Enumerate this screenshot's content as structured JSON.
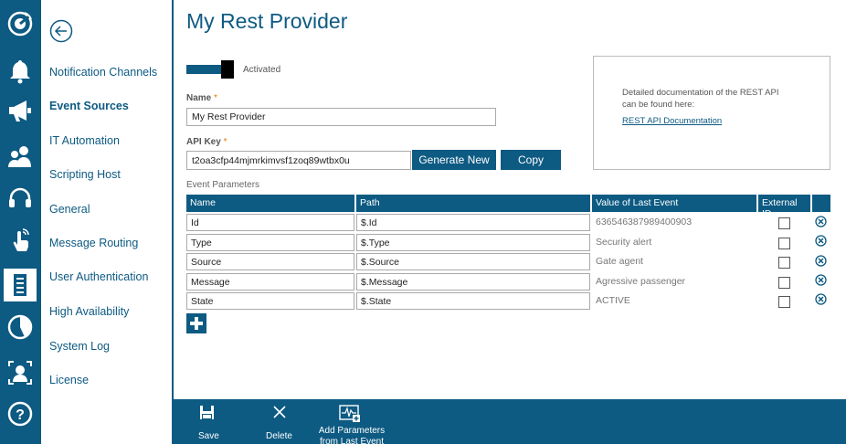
{
  "rail": {
    "icons": [
      "radar-icon",
      "bell-icon",
      "megaphone-icon",
      "users-icon",
      "headset-icon",
      "touch-icon",
      "server-icon",
      "pie-chart-icon",
      "user-frame-icon",
      "help-icon"
    ]
  },
  "nav": {
    "items": [
      {
        "label": "Notification Channels"
      },
      {
        "label": "Event Sources"
      },
      {
        "label": "IT Automation"
      },
      {
        "label": "Scripting Host"
      },
      {
        "label": "General"
      },
      {
        "label": "Message Routing"
      },
      {
        "label": "User Authentication"
      },
      {
        "label": "High Availability"
      },
      {
        "label": "System Log"
      },
      {
        "label": "License"
      }
    ],
    "active_index": 1
  },
  "page": {
    "title": "My Rest Provider",
    "toggle_label": "Activated",
    "toggle_on": true
  },
  "form": {
    "name_label": "Name",
    "name_value": "My Rest Provider",
    "apikey_label": "API Key",
    "apikey_value": "t2oa3cfp44mjmrkimvsf1zoq89wtbx0u",
    "required_mark": "*",
    "generate_label": "Generate New",
    "copy_label": "Copy"
  },
  "doc": {
    "text_line1": "Detailed documentation of the REST API",
    "text_line2": "can be found here:",
    "link": "REST API Documentation"
  },
  "params": {
    "section_label": "Event Parameters",
    "columns": [
      "Name",
      "Path",
      "Value of Last Event",
      "External ID"
    ],
    "rows": [
      {
        "name": "Id",
        "path": "$.Id",
        "value": "636546387989400903",
        "external": false
      },
      {
        "name": "Type",
        "path": "$.Type",
        "value": "Security alert",
        "external": false
      },
      {
        "name": "Source",
        "path": "$.Source",
        "value": "Gate agent",
        "external": false
      },
      {
        "name": "Message",
        "path": "$.Message",
        "value": "Agressive passenger",
        "external": false
      },
      {
        "name": "State",
        "path": "$.State",
        "value": "ACTIVE",
        "external": false
      }
    ]
  },
  "toolbar": {
    "save_label": "Save",
    "delete_label": "Delete",
    "addparams_label_line1": "Add Parameters",
    "addparams_label_line2": "from Last Event"
  },
  "colors": {
    "primary": "#0d5a82",
    "required": "#e07a00"
  }
}
